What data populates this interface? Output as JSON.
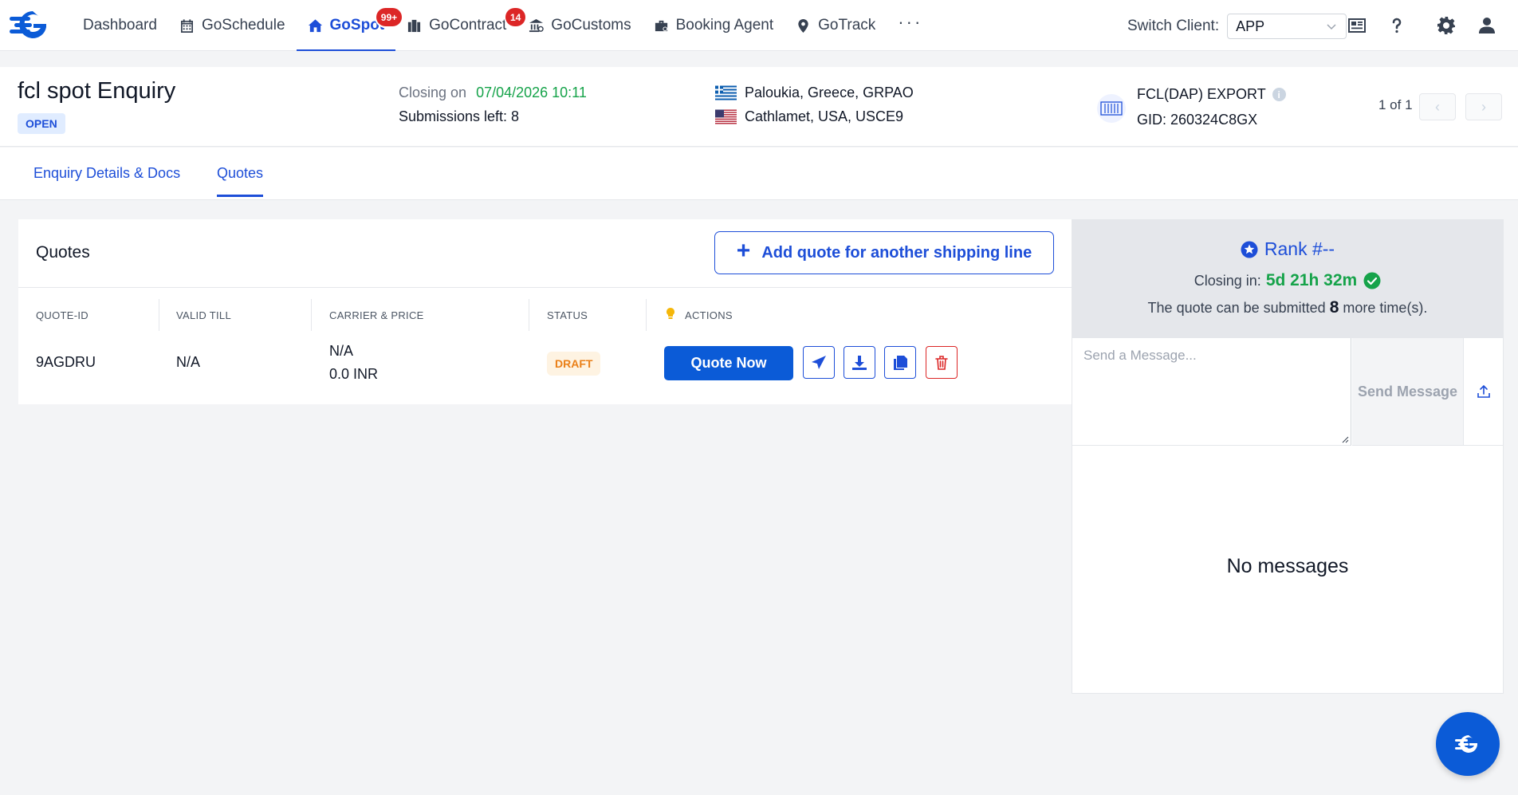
{
  "nav": {
    "items": [
      {
        "label": "Dashboard",
        "icon": "none"
      },
      {
        "label": "GoSchedule",
        "icon": "calendar-icon"
      },
      {
        "label": "GoSpot",
        "icon": "home-icon",
        "badge": "99+",
        "active": true
      },
      {
        "label": "GoContract",
        "icon": "building-icon",
        "badge": "14"
      },
      {
        "label": "GoCustoms",
        "icon": "bank-icon"
      },
      {
        "label": "Booking Agent",
        "icon": "briefcase-icon"
      },
      {
        "label": "GoTrack",
        "icon": "location-pin-icon"
      }
    ],
    "more": "···",
    "switch_client_label": "Switch Client:",
    "client_value": "APP"
  },
  "header": {
    "title": "fcl spot Enquiry",
    "status": "OPEN",
    "closing_label": "Closing on",
    "closing_date": "07/04/2026 10:11",
    "submissions_left": "Submissions left: 8",
    "origin": "Paloukia, Greece, GRPAO",
    "destination": "Cathlamet, USA, USCE9",
    "shipment_type": "FCL(DAP) EXPORT",
    "gid": "GID: 260324C8GX",
    "pager": "1 of 1"
  },
  "tabs": [
    {
      "label": "Enquiry Details & Docs"
    },
    {
      "label": "Quotes",
      "active": true
    }
  ],
  "quotes": {
    "title": "Quotes",
    "add_button": "Add quote for another shipping line",
    "columns": [
      "QUOTE-ID",
      "VALID TILL",
      "CARRIER & PRICE",
      "STATUS",
      "ACTIONS"
    ],
    "rows": [
      {
        "id": "9AGDRU",
        "valid_till": "N/A",
        "carrier": "N/A",
        "price": "0.0 INR",
        "status": "DRAFT",
        "action_label": "Quote Now"
      }
    ]
  },
  "rank": {
    "title": "Rank #--",
    "closing_label": "Closing in:",
    "closing_time": "5d 21h 32m",
    "submit_prefix": "The quote can be submitted",
    "submit_count": "8",
    "submit_suffix": "more time(s)."
  },
  "messages": {
    "placeholder": "Send a Message...",
    "send_label": "Send Message",
    "empty_text": "No messages"
  },
  "colors": {
    "brand": "#0b5bd7",
    "accent": "#1d4ed8",
    "success": "#16a34a",
    "danger": "#dc2626",
    "draft": "#ea7f17"
  }
}
